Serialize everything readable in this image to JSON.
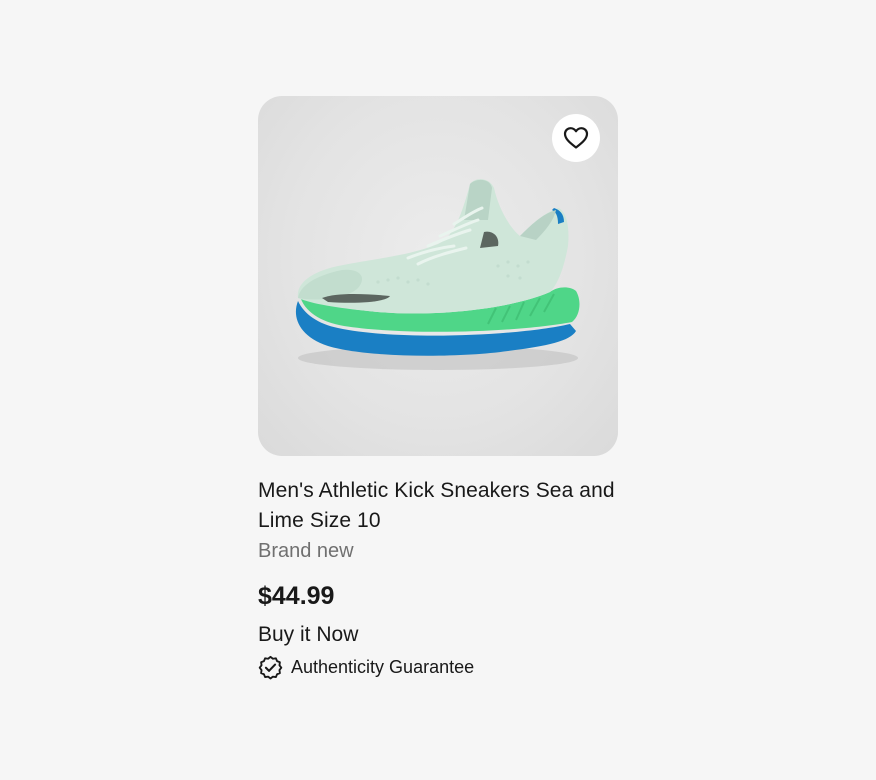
{
  "listing": {
    "title": "Men's Athletic Kick Sneakers Sea and Lime Size 10",
    "condition": "Brand new",
    "price": "$44.99",
    "buying_format": "Buy it Now",
    "guarantee_label": "Authenticity Guarantee",
    "image_alt": "Mint green athletic sneaker with lime green sole and blue outsole",
    "wishlist_icon": "heart-outline-icon",
    "guarantee_icon": "verified-badge-icon"
  },
  "colors": {
    "page_background": "#f6f6f6",
    "text_primary": "#191919",
    "text_secondary": "#707070",
    "shoe_upper": "#cfe6d9",
    "shoe_midsole": "#4fd688",
    "shoe_outsole": "#1a7fc4"
  }
}
